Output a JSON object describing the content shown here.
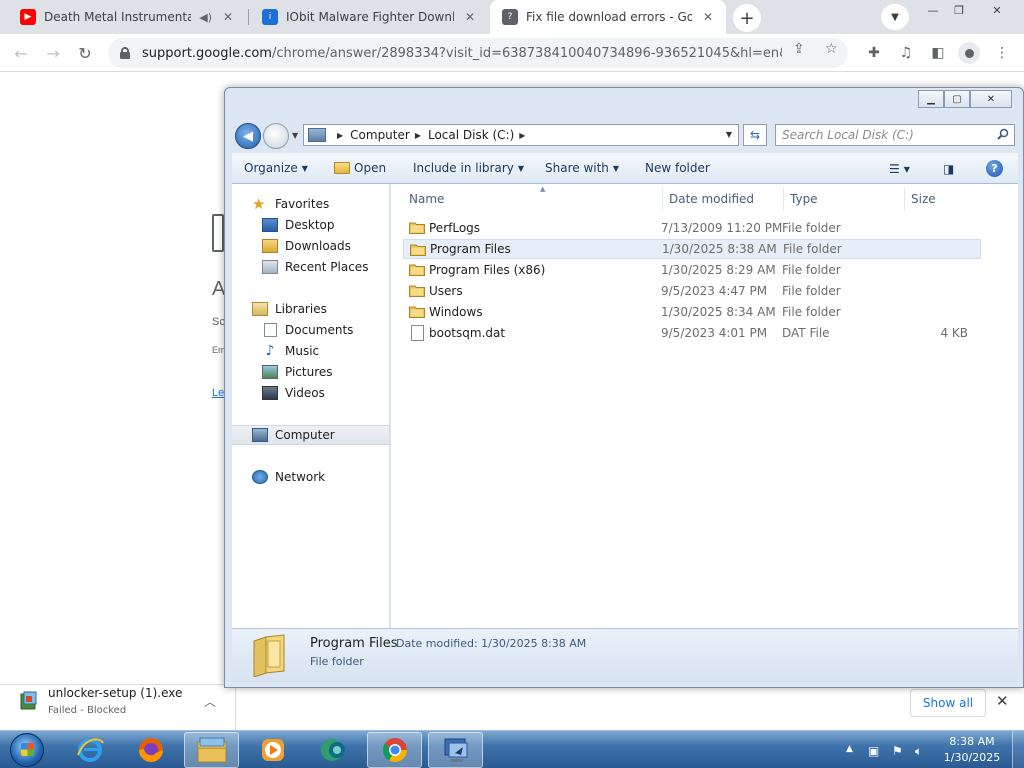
{
  "browser": {
    "tabs": [
      {
        "title": "Death Metal Instrumental //",
        "favicon": "youtube-icon",
        "audio": true,
        "active": false
      },
      {
        "title": "IObit Malware Fighter Download",
        "favicon": "iobit-icon",
        "active": false
      },
      {
        "title": "Fix file download errors - Google",
        "favicon": "google-help-icon",
        "active": true
      }
    ],
    "url_host": "support.google.com",
    "url_path": "/chrome/answer/2898334?visit_id=638738410040734896-936521045&hl=en&rd...",
    "page_fragments": [
      "A",
      "Sc",
      "Em",
      "Le"
    ]
  },
  "download_bar": {
    "file_name": "unlocker-setup (1).exe",
    "status": "Failed - Blocked",
    "show_all": "Show all"
  },
  "explorer": {
    "breadcrumb": [
      "Computer",
      "Local Disk (C:)"
    ],
    "search_placeholder": "Search Local Disk (C:)",
    "commands": {
      "organize": "Organize",
      "open": "Open",
      "include_in_library": "Include in library",
      "share_with": "Share with",
      "new_folder": "New folder"
    },
    "nav": {
      "favorites": "Favorites",
      "desktop": "Desktop",
      "downloads": "Downloads",
      "recent_places": "Recent Places",
      "libraries": "Libraries",
      "documents": "Documents",
      "music": "Music",
      "pictures": "Pictures",
      "videos": "Videos",
      "computer": "Computer",
      "network": "Network"
    },
    "columns": {
      "name": "Name",
      "date": "Date modified",
      "type": "Type",
      "size": "Size"
    },
    "files": [
      {
        "name": "PerfLogs",
        "date": "7/13/2009 11:20 PM",
        "type": "File folder",
        "size": "",
        "kind": "folder"
      },
      {
        "name": "Program Files",
        "date": "1/30/2025 8:38 AM",
        "type": "File folder",
        "size": "",
        "kind": "folder",
        "selected": true
      },
      {
        "name": "Program Files (x86)",
        "date": "1/30/2025 8:29 AM",
        "type": "File folder",
        "size": "",
        "kind": "folder"
      },
      {
        "name": "Users",
        "date": "9/5/2023 4:47 PM",
        "type": "File folder",
        "size": "",
        "kind": "folder"
      },
      {
        "name": "Windows",
        "date": "1/30/2025 8:34 AM",
        "type": "File folder",
        "size": "",
        "kind": "folder"
      },
      {
        "name": "bootsqm.dat",
        "date": "9/5/2023 4:01 PM",
        "type": "DAT File",
        "size": "4 KB",
        "kind": "file"
      }
    ],
    "details": {
      "name": "Program Files",
      "modified_label": "Date modified:",
      "modified_value": "1/30/2025 8:38 AM",
      "type": "File folder"
    }
  },
  "taskbar": {
    "apps": [
      "internet-explorer-icon",
      "firefox-icon",
      "windows-explorer-icon",
      "media-player-icon",
      "app-icon",
      "chrome-icon",
      "remote-desktop-icon"
    ],
    "time": "8:38 AM",
    "date": "1/30/2025"
  }
}
